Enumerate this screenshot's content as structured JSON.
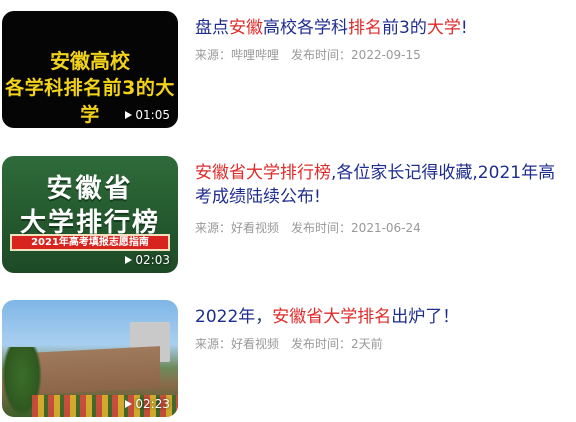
{
  "videos": [
    {
      "title_parts": [
        {
          "text": "盘点",
          "hl": false
        },
        {
          "text": "安徽",
          "hl": true
        },
        {
          "text": "高校各学科",
          "hl": false
        },
        {
          "text": "排名",
          "hl": true
        },
        {
          "text": "前3的",
          "hl": false
        },
        {
          "text": "大学",
          "hl": true
        },
        {
          "text": "!",
          "hl": false
        }
      ],
      "thumb_line1": "安徽高校",
      "thumb_line2": "各学科排名前3的大学",
      "duration": "01:05",
      "source_label": "来源：",
      "source": "哔哩哔哩",
      "date_label": "发布时间：",
      "date": "2022-09-15"
    },
    {
      "title_parts": [
        {
          "text": "安徽省大学排行榜",
          "hl": true
        },
        {
          "text": ",各位家长记得收藏,2021年高考成绩陆续公布!",
          "hl": false
        }
      ],
      "thumb_line1": "安徽省",
      "thumb_line2": "大学排行榜",
      "thumb_banner": "2021年高考填报志愿指南",
      "duration": "02:03",
      "source_label": "来源：",
      "source": "好看视频",
      "date_label": "发布时间：",
      "date": "2021-06-24"
    },
    {
      "title_parts": [
        {
          "text": "2022年，",
          "hl": false
        },
        {
          "text": "安徽省大学排名",
          "hl": true
        },
        {
          "text": "出炉了！",
          "hl": false
        }
      ],
      "duration": "02:23",
      "source_label": "来源：",
      "source": "好看视频",
      "date_label": "发布时间：",
      "date": "2天前"
    }
  ],
  "colors": {
    "title": "#1f2d8f",
    "highlight": "#e02b2b",
    "meta": "#999999"
  },
  "icons": {
    "duration": "play-icon"
  }
}
